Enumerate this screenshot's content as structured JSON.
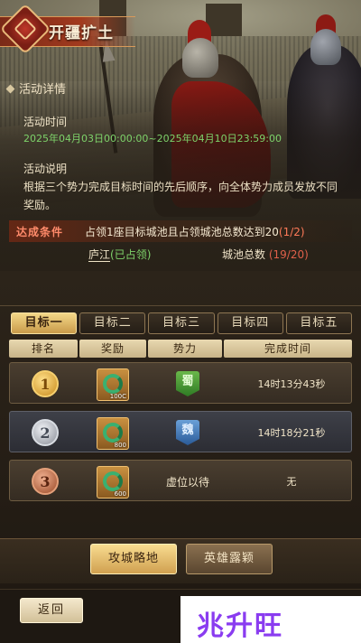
{
  "header": {
    "title": "开疆扩土"
  },
  "details": {
    "heading": "活动详情",
    "time_label": "活动时间",
    "time_value": "2025年04月03日00:00:00~2025年04月10日23:59:00",
    "desc_label": "活动说明",
    "desc_value": "根据三个势力完成目标时间的先后顺序，向全体势力成员发放不同奖励。"
  },
  "condition": {
    "label": "达成条件",
    "text_prefix": "占领1座目标城池且占领城池总数达到20",
    "progress": "(1/2)"
  },
  "city": {
    "name": "庐江",
    "status": "(已占领)",
    "total_label": "城池总数",
    "total_value": "(19/20)"
  },
  "tabs": [
    {
      "label": "目标一",
      "active": true
    },
    {
      "label": "目标二",
      "active": false
    },
    {
      "label": "目标三",
      "active": false
    },
    {
      "label": "目标四",
      "active": false
    },
    {
      "label": "目标五",
      "active": false
    }
  ],
  "table": {
    "headers": [
      "排名",
      "奖励",
      "势力",
      "完成时间"
    ],
    "rows": [
      {
        "rank": "1",
        "reward_qty": "100C",
        "faction": "蜀",
        "time": "14时13分43秒"
      },
      {
        "rank": "2",
        "reward_qty": "800",
        "faction": "魏",
        "time": "14时18分21秒"
      },
      {
        "rank": "3",
        "reward_qty": "600",
        "faction_text": "虚位以待",
        "time": "无"
      }
    ]
  },
  "bottom_tabs": [
    {
      "label": "攻城略地",
      "active": true
    },
    {
      "label": "英雄露颖",
      "active": false
    }
  ],
  "footer": {
    "back_label": "返回"
  },
  "watermark": {
    "text": "兆升旺"
  },
  "colors": {
    "accent_gold": "#f4d888",
    "green": "#7ed36a",
    "red": "#e0604a"
  }
}
